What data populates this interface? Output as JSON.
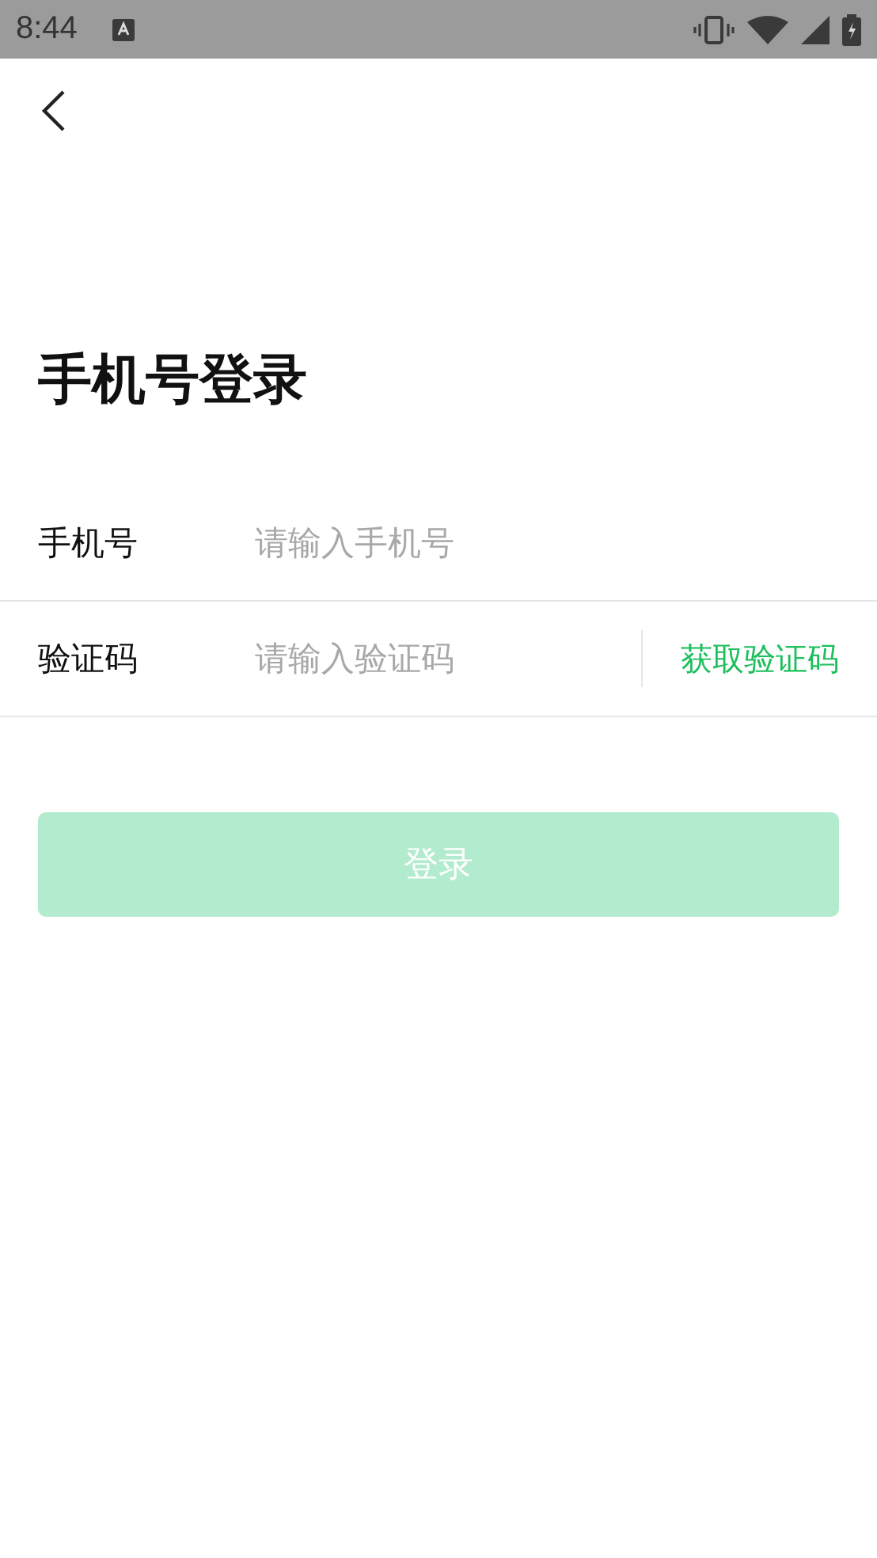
{
  "status_bar": {
    "time": "8:44"
  },
  "title": "手机号登录",
  "fields": [
    {
      "kind": "phone",
      "label": "手机号",
      "placeholder": "请输入手机号"
    },
    {
      "kind": "code",
      "label": "验证码",
      "placeholder": "请输入验证码",
      "action": "获取验证码"
    }
  ],
  "login_button": {
    "label": "登录",
    "disabled": true
  }
}
